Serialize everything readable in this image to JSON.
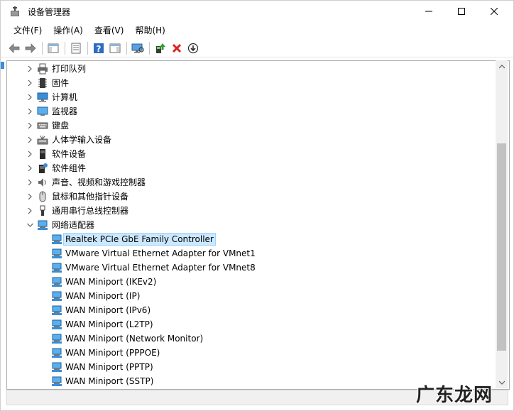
{
  "window": {
    "title": "设备管理器",
    "controls": {
      "minimize": "minimize",
      "maximize": "maximize",
      "close": "close"
    }
  },
  "menu": {
    "items": [
      {
        "label": "文件(F)"
      },
      {
        "label": "操作(A)"
      },
      {
        "label": "查看(V)"
      },
      {
        "label": "帮助(H)"
      }
    ]
  },
  "toolbar": {
    "icons": [
      "back-arrow-icon",
      "forward-arrow-icon",
      "console-tree-icon",
      "properties-icon",
      "help-icon",
      "action-pane-icon",
      "scan-hardware-icon",
      "update-driver-icon",
      "uninstall-device-icon",
      "download-driver-icon"
    ]
  },
  "tree": {
    "categories": [
      {
        "label": "打印队列",
        "expanded": false,
        "icon": "printer-icon"
      },
      {
        "label": "固件",
        "expanded": false,
        "icon": "firmware-icon"
      },
      {
        "label": "计算机",
        "expanded": false,
        "icon": "computer-icon"
      },
      {
        "label": "监视器",
        "expanded": false,
        "icon": "monitor-icon"
      },
      {
        "label": "键盘",
        "expanded": false,
        "icon": "keyboard-icon"
      },
      {
        "label": "人体学输入设备",
        "expanded": false,
        "icon": "hid-icon"
      },
      {
        "label": "软件设备",
        "expanded": false,
        "icon": "software-device-icon"
      },
      {
        "label": "软件组件",
        "expanded": false,
        "icon": "software-component-icon"
      },
      {
        "label": "声音、视频和游戏控制器",
        "expanded": false,
        "icon": "sound-icon"
      },
      {
        "label": "鼠标和其他指针设备",
        "expanded": false,
        "icon": "mouse-icon"
      },
      {
        "label": "通用串行总线控制器",
        "expanded": false,
        "icon": "usb-icon"
      },
      {
        "label": "网络适配器",
        "expanded": true,
        "icon": "network-adapter-icon"
      }
    ],
    "network_adapters": [
      {
        "label": "Realtek PCIe GbE Family Controller",
        "selected": true
      },
      {
        "label": "VMware Virtual Ethernet Adapter for VMnet1",
        "selected": false
      },
      {
        "label": "VMware Virtual Ethernet Adapter for VMnet8",
        "selected": false
      },
      {
        "label": "WAN Miniport (IKEv2)",
        "selected": false
      },
      {
        "label": "WAN Miniport (IP)",
        "selected": false
      },
      {
        "label": "WAN Miniport (IPv6)",
        "selected": false
      },
      {
        "label": "WAN Miniport (L2TP)",
        "selected": false
      },
      {
        "label": "WAN Miniport (Network Monitor)",
        "selected": false
      },
      {
        "label": "WAN Miniport (PPPOE)",
        "selected": false
      },
      {
        "label": "WAN Miniport (PPTP)",
        "selected": false
      },
      {
        "label": "WAN Miniport (SSTP)",
        "selected": false
      }
    ]
  },
  "watermark": {
    "text": "广东龙网"
  },
  "colors": {
    "selection_bg": "#cce8ff",
    "selection_border": "#99d1ff",
    "network_icon": "#3a8ed8",
    "delete_red": "#e02020",
    "scroll_thumb": "#c2c2c2"
  }
}
